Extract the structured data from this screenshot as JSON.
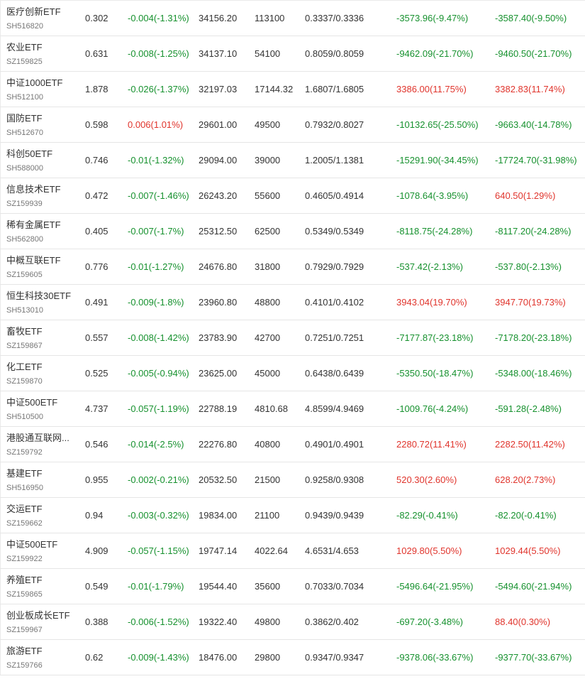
{
  "colors": {
    "up": "#e0342c",
    "down": "#16912e",
    "text": "#333333",
    "code": "#777777",
    "border": "#e6e6e6"
  },
  "rows": [
    {
      "name": "医疗创新ETF",
      "code": "SH516820",
      "price": "0.302",
      "change": "-0.004(-1.31%)",
      "change_dir": "down",
      "amount": "34156.20",
      "shares": "113100",
      "cost": "0.3337/0.3336",
      "pnl1": "-3573.96(-9.47%)",
      "pnl1_dir": "down",
      "pnl2": "-3587.40(-9.50%)",
      "pnl2_dir": "down"
    },
    {
      "name": "农业ETF",
      "code": "SZ159825",
      "price": "0.631",
      "change": "-0.008(-1.25%)",
      "change_dir": "down",
      "amount": "34137.10",
      "shares": "54100",
      "cost": "0.8059/0.8059",
      "pnl1": "-9462.09(-21.70%)",
      "pnl1_dir": "down",
      "pnl2": "-9460.50(-21.70%)",
      "pnl2_dir": "down"
    },
    {
      "name": "中证1000ETF",
      "code": "SH512100",
      "price": "1.878",
      "change": "-0.026(-1.37%)",
      "change_dir": "down",
      "amount": "32197.03",
      "shares": "17144.32",
      "cost": "1.6807/1.6805",
      "pnl1": "3386.00(11.75%)",
      "pnl1_dir": "up",
      "pnl2": "3382.83(11.74%)",
      "pnl2_dir": "up"
    },
    {
      "name": "国防ETF",
      "code": "SH512670",
      "price": "0.598",
      "change": "0.006(1.01%)",
      "change_dir": "up",
      "amount": "29601.00",
      "shares": "49500",
      "cost": "0.7932/0.8027",
      "pnl1": "-10132.65(-25.50%)",
      "pnl1_dir": "down",
      "pnl2": "-9663.40(-14.78%)",
      "pnl2_dir": "down"
    },
    {
      "name": "科创50ETF",
      "code": "SH588000",
      "price": "0.746",
      "change": "-0.01(-1.32%)",
      "change_dir": "down",
      "amount": "29094.00",
      "shares": "39000",
      "cost": "1.2005/1.1381",
      "pnl1": "-15291.90(-34.45%)",
      "pnl1_dir": "down",
      "pnl2": "-17724.70(-31.98%)",
      "pnl2_dir": "down"
    },
    {
      "name": "信息技术ETF",
      "code": "SZ159939",
      "price": "0.472",
      "change": "-0.007(-1.46%)",
      "change_dir": "down",
      "amount": "26243.20",
      "shares": "55600",
      "cost": "0.4605/0.4914",
      "pnl1": "-1078.64(-3.95%)",
      "pnl1_dir": "down",
      "pnl2": "640.50(1.29%)",
      "pnl2_dir": "up"
    },
    {
      "name": "稀有金属ETF",
      "code": "SH562800",
      "price": "0.405",
      "change": "-0.007(-1.7%)",
      "change_dir": "down",
      "amount": "25312.50",
      "shares": "62500",
      "cost": "0.5349/0.5349",
      "pnl1": "-8118.75(-24.28%)",
      "pnl1_dir": "down",
      "pnl2": "-8117.20(-24.28%)",
      "pnl2_dir": "down"
    },
    {
      "name": "中概互联ETF",
      "code": "SZ159605",
      "price": "0.776",
      "change": "-0.01(-1.27%)",
      "change_dir": "down",
      "amount": "24676.80",
      "shares": "31800",
      "cost": "0.7929/0.7929",
      "pnl1": "-537.42(-2.13%)",
      "pnl1_dir": "down",
      "pnl2": "-537.80(-2.13%)",
      "pnl2_dir": "down"
    },
    {
      "name": "恒生科技30ETF",
      "code": "SH513010",
      "price": "0.491",
      "change": "-0.009(-1.8%)",
      "change_dir": "down",
      "amount": "23960.80",
      "shares": "48800",
      "cost": "0.4101/0.4102",
      "pnl1": "3943.04(19.70%)",
      "pnl1_dir": "up",
      "pnl2": "3947.70(19.73%)",
      "pnl2_dir": "up"
    },
    {
      "name": "畜牧ETF",
      "code": "SZ159867",
      "price": "0.557",
      "change": "-0.008(-1.42%)",
      "change_dir": "down",
      "amount": "23783.90",
      "shares": "42700",
      "cost": "0.7251/0.7251",
      "pnl1": "-7177.87(-23.18%)",
      "pnl1_dir": "down",
      "pnl2": "-7178.20(-23.18%)",
      "pnl2_dir": "down"
    },
    {
      "name": "化工ETF",
      "code": "SZ159870",
      "price": "0.525",
      "change": "-0.005(-0.94%)",
      "change_dir": "down",
      "amount": "23625.00",
      "shares": "45000",
      "cost": "0.6438/0.6439",
      "pnl1": "-5350.50(-18.47%)",
      "pnl1_dir": "down",
      "pnl2": "-5348.00(-18.46%)",
      "pnl2_dir": "down"
    },
    {
      "name": "中证500ETF",
      "code": "SH510500",
      "price": "4.737",
      "change": "-0.057(-1.19%)",
      "change_dir": "down",
      "amount": "22788.19",
      "shares": "4810.68",
      "cost": "4.8599/4.9469",
      "pnl1": "-1009.76(-4.24%)",
      "pnl1_dir": "down",
      "pnl2": "-591.28(-2.48%)",
      "pnl2_dir": "down"
    },
    {
      "name": "港股通互联网...",
      "code": "SZ159792",
      "price": "0.546",
      "change": "-0.014(-2.5%)",
      "change_dir": "down",
      "amount": "22276.80",
      "shares": "40800",
      "cost": "0.4901/0.4901",
      "pnl1": "2280.72(11.41%)",
      "pnl1_dir": "up",
      "pnl2": "2282.50(11.42%)",
      "pnl2_dir": "up"
    },
    {
      "name": "基建ETF",
      "code": "SH516950",
      "price": "0.955",
      "change": "-0.002(-0.21%)",
      "change_dir": "down",
      "amount": "20532.50",
      "shares": "21500",
      "cost": "0.9258/0.9308",
      "pnl1": "520.30(2.60%)",
      "pnl1_dir": "up",
      "pnl2": "628.20(2.73%)",
      "pnl2_dir": "up"
    },
    {
      "name": "交运ETF",
      "code": "SZ159662",
      "price": "0.94",
      "change": "-0.003(-0.32%)",
      "change_dir": "down",
      "amount": "19834.00",
      "shares": "21100",
      "cost": "0.9439/0.9439",
      "pnl1": "-82.29(-0.41%)",
      "pnl1_dir": "down",
      "pnl2": "-82.20(-0.41%)",
      "pnl2_dir": "down"
    },
    {
      "name": "中证500ETF",
      "code": "SZ159922",
      "price": "4.909",
      "change": "-0.057(-1.15%)",
      "change_dir": "down",
      "amount": "19747.14",
      "shares": "4022.64",
      "cost": "4.6531/4.653",
      "pnl1": "1029.80(5.50%)",
      "pnl1_dir": "up",
      "pnl2": "1029.44(5.50%)",
      "pnl2_dir": "up"
    },
    {
      "name": "养殖ETF",
      "code": "SZ159865",
      "price": "0.549",
      "change": "-0.01(-1.79%)",
      "change_dir": "down",
      "amount": "19544.40",
      "shares": "35600",
      "cost": "0.7033/0.7034",
      "pnl1": "-5496.64(-21.95%)",
      "pnl1_dir": "down",
      "pnl2": "-5494.60(-21.94%)",
      "pnl2_dir": "down"
    },
    {
      "name": "创业板成长ETF",
      "code": "SZ159967",
      "price": "0.388",
      "change": "-0.006(-1.52%)",
      "change_dir": "down",
      "amount": "19322.40",
      "shares": "49800",
      "cost": "0.3862/0.402",
      "pnl1": "-697.20(-3.48%)",
      "pnl1_dir": "down",
      "pnl2": "88.40(0.30%)",
      "pnl2_dir": "up"
    },
    {
      "name": "旅游ETF",
      "code": "SZ159766",
      "price": "0.62",
      "change": "-0.009(-1.43%)",
      "change_dir": "down",
      "amount": "18476.00",
      "shares": "29800",
      "cost": "0.9347/0.9347",
      "pnl1": "-9378.06(-33.67%)",
      "pnl1_dir": "down",
      "pnl2": "-9377.70(-33.67%)",
      "pnl2_dir": "down"
    }
  ]
}
